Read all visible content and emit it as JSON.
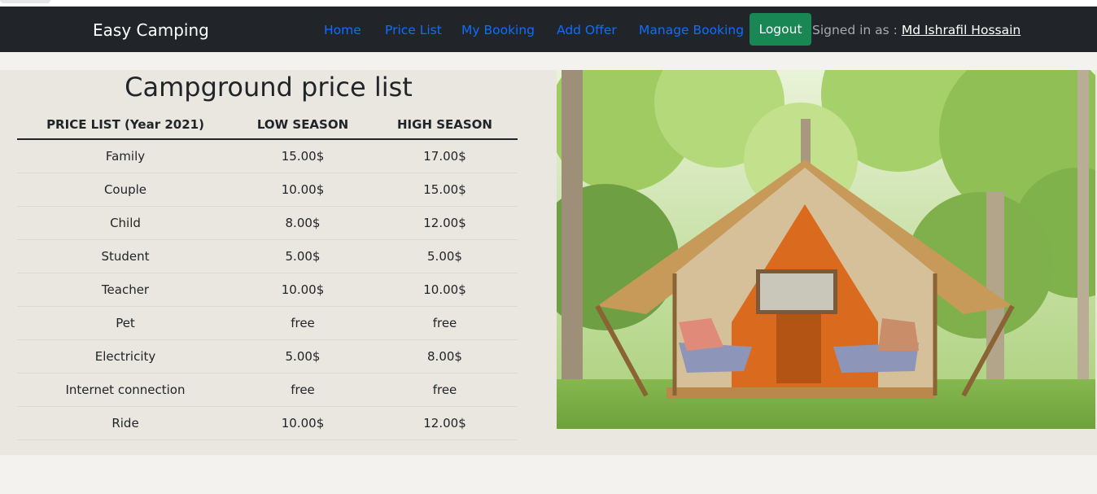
{
  "navbar": {
    "brand": "Easy Camping",
    "links": [
      "Home",
      "Price List",
      "My Booking",
      "Add Offer",
      "Manage Booking"
    ],
    "logout_label": "Logout",
    "signed_in_prefix": "Signed in as :",
    "user_name": "Md Ishrafil Hossain",
    "colors": {
      "background": "#212529",
      "link": "#0d6efd",
      "logout": "#198754"
    }
  },
  "main": {
    "title": "Campground price list",
    "table": {
      "headers": [
        "PRICE LIST (Year 2021)",
        "LOW SEASON",
        "HIGH SEASON"
      ],
      "rows": [
        [
          "Family",
          "15.00$",
          "17.00$"
        ],
        [
          "Couple",
          "10.00$",
          "15.00$"
        ],
        [
          "Child",
          "8.00$",
          "12.00$"
        ],
        [
          "Student",
          "5.00$",
          "5.00$"
        ],
        [
          "Teacher",
          "10.00$",
          "10.00$"
        ],
        [
          "Pet",
          "free",
          "free"
        ],
        [
          "Electricity",
          "5.00$",
          "8.00$"
        ],
        [
          "Internet connection",
          "free",
          "free"
        ],
        [
          "Ride",
          "10.00$",
          "12.00$"
        ]
      ]
    },
    "image_subject": "glamping-tent-in-forest"
  }
}
